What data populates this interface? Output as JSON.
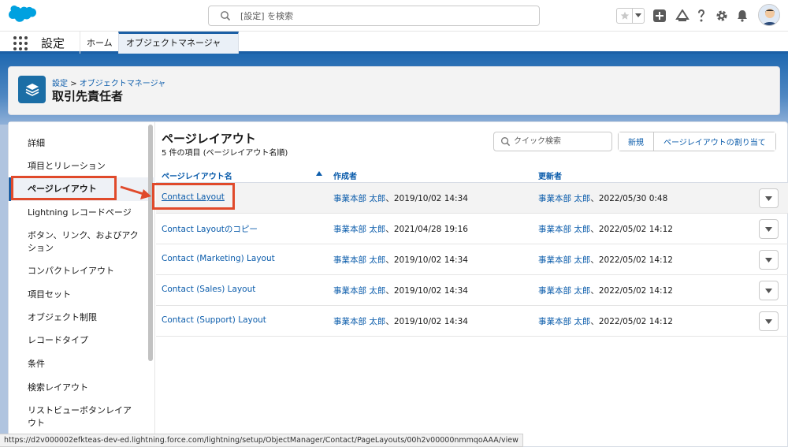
{
  "header": {
    "search_placeholder": "[設定] を検索"
  },
  "nav": {
    "app_name": "設定",
    "home_tab": "ホーム",
    "active_tab": "オブジェクトマネージャ"
  },
  "setup_header": {
    "breadcrumb_setup": "設定",
    "breadcrumb_sep": ">",
    "breadcrumb_object_manager": "オブジェクトマネージャ",
    "object_title": "取引先責任者"
  },
  "sidebar": {
    "items": [
      {
        "label": "詳細"
      },
      {
        "label": "項目とリレーション"
      },
      {
        "label": "ページレイアウト"
      },
      {
        "label": "Lightning レコードページ"
      },
      {
        "label": "ボタン、リンク、およびアク"
      },
      {
        "label": "ション"
      },
      {
        "label": "コンパクトレイアウト"
      },
      {
        "label": "項目セット"
      },
      {
        "label": "オブジェクト制限"
      },
      {
        "label": "レコードタイプ"
      },
      {
        "label": "条件"
      },
      {
        "label": "検索レイアウト"
      },
      {
        "label": "リストビューボタンレイア"
      },
      {
        "label": "ウト"
      }
    ]
  },
  "content": {
    "title": "ページレイアウト",
    "subtitle": "5 件の項目 (ページレイアウト名順)",
    "quick_search_placeholder": "クイック検索",
    "new_button": "新規",
    "assign_button": "ページレイアウトの割り当て",
    "columns": [
      "ページレイアウト名",
      "作成者",
      "更新者"
    ],
    "rows": [
      {
        "name": "Contact Layout",
        "created_user": "事業本部 太郎",
        "created_date": "、2019/10/02 14:34",
        "modified_user": "事業本部 太郎",
        "modified_date": "、2022/05/30 0:48"
      },
      {
        "name": "Contact Layoutのコピー",
        "created_user": "事業本部 太郎",
        "created_date": "、2021/04/28 19:16",
        "modified_user": "事業本部 太郎",
        "modified_date": "、2022/05/02 14:12"
      },
      {
        "name": "Contact (Marketing) Layout",
        "created_user": "事業本部 太郎",
        "created_date": "、2019/10/02 14:34",
        "modified_user": "事業本部 太郎",
        "modified_date": "、2022/05/02 14:12"
      },
      {
        "name": "Contact (Sales) Layout",
        "created_user": "事業本部 太郎",
        "created_date": "、2019/10/02 14:34",
        "modified_user": "事業本部 太郎",
        "modified_date": "、2022/05/02 14:12"
      },
      {
        "name": "Contact (Support) Layout",
        "created_user": "事業本部 太郎",
        "created_date": "、2019/10/02 14:34",
        "modified_user": "事業本部 太郎",
        "modified_date": "、2022/05/02 14:12"
      }
    ]
  },
  "status_url": "https://d2v000002efkteas-dev-ed.lightning.force.com/lightning/setup/ObjectManager/Contact/PageLayouts/00h2v00000nmmqoAAA/view",
  "colors": {
    "brand": "#1b5fa5",
    "link": "#0b5cab",
    "highlight": "#e04a2b",
    "logo": "#00a1e0"
  },
  "icons": {
    "logo": "salesforce-cloud-logo",
    "search": "search-icon",
    "favorites": "star-icon",
    "add": "plus-icon",
    "trailhead": "trailhead-icon",
    "help": "question-icon",
    "setup": "gear-icon",
    "notifications": "bell-icon",
    "app_launcher": "waffle-icon",
    "object": "stack-icon"
  }
}
